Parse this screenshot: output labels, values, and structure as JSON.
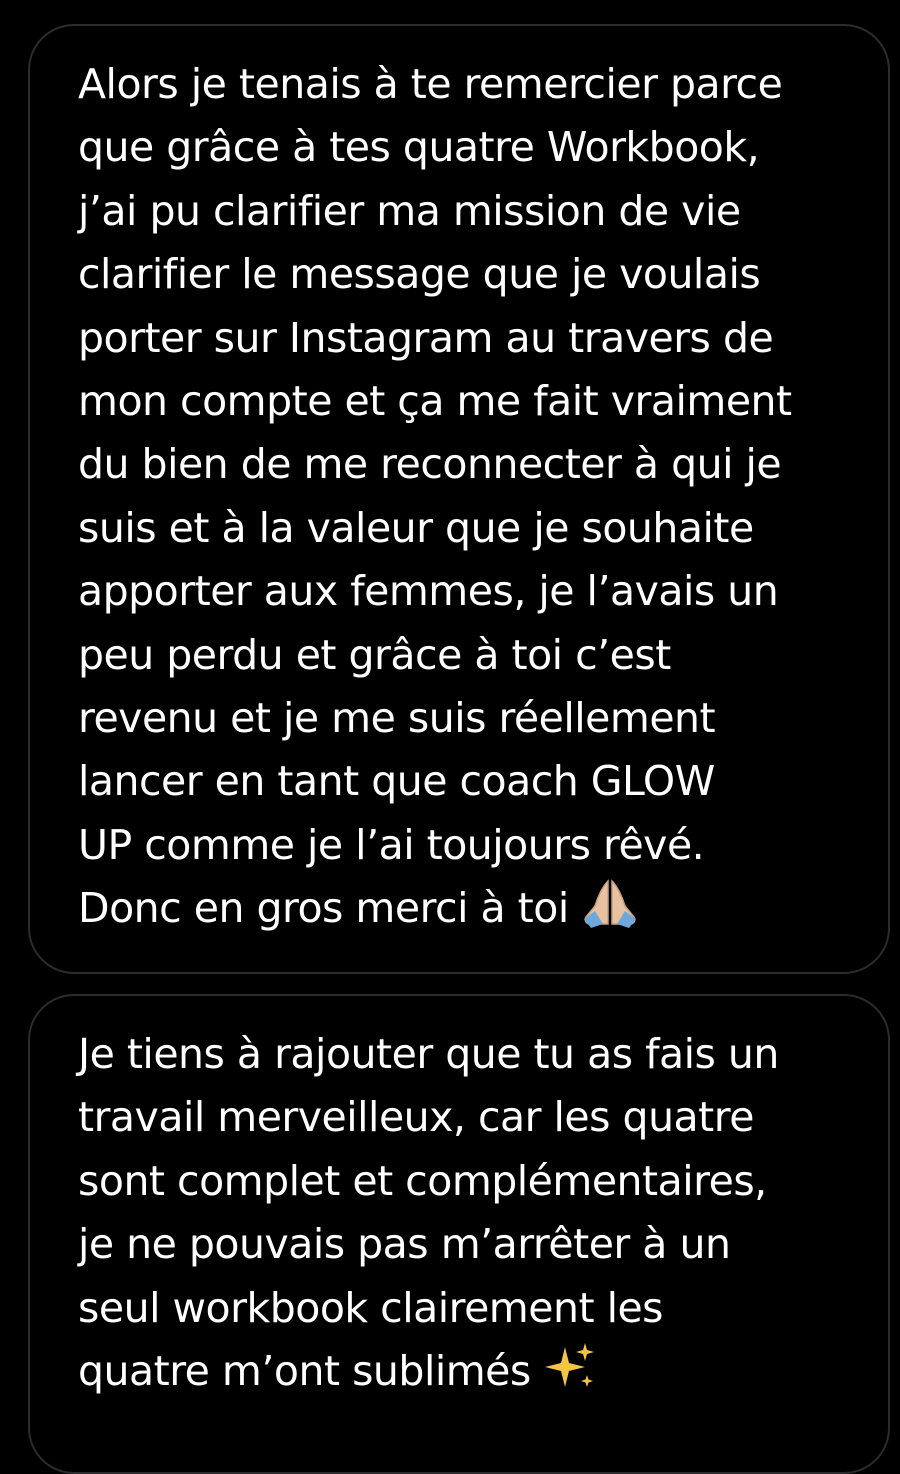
{
  "messages": [
    {
      "lines": [
        "Alors je tenais à te remercier parce",
        "que grâce à tes quatre Workbook,",
        "j’ai pu clarifier ma mission de vie",
        "clarifier le message que je voulais",
        "porter sur Instagram au travers de",
        "mon compte et ça me fait vraiment",
        "du bien de me reconnecter à qui je",
        "suis et à la valeur que je souhaite",
        "apporter aux femmes, je l’avais un",
        "peu perdu et grâce à toi c’est",
        "revenu et je me suis réellement",
        "lancer en tant que coach GLOW",
        "UP comme je l’ai toujours rêvé.",
        "Donc en gros merci à toi"
      ],
      "emoji": "folded-hands-icon"
    },
    {
      "lines": [
        "Je tiens à rajouter que tu as fais un",
        "travail merveilleux, car les quatre",
        "sont complet et complémentaires,",
        "je ne pouvais pas m’arrêter à un",
        "seul workbook clairement les",
        "quatre m’ont sublimés"
      ],
      "emoji": "sparkles-icon"
    }
  ],
  "colors": {
    "background": "#000000",
    "bubble_border": "#2c2c2e",
    "text": "#ffffff",
    "sparkle": "#f5c542",
    "skin": "#e8c2a0"
  }
}
